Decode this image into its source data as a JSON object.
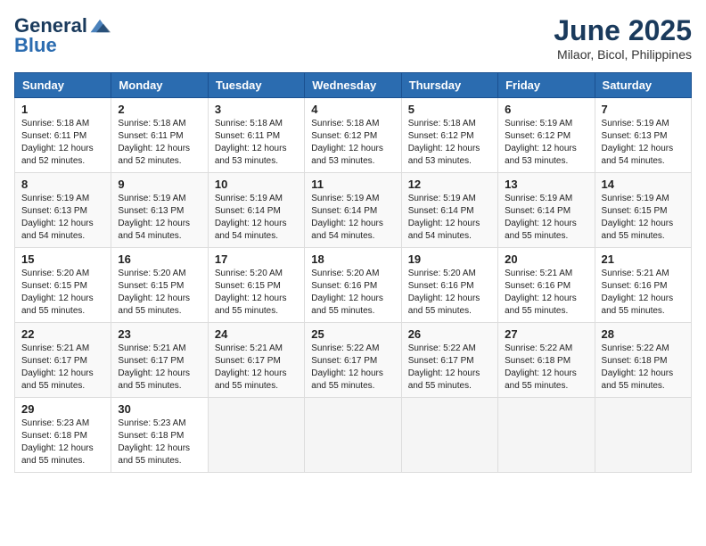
{
  "header": {
    "logo_general": "General",
    "logo_blue": "Blue",
    "month": "June 2025",
    "location": "Milaor, Bicol, Philippines"
  },
  "days_of_week": [
    "Sunday",
    "Monday",
    "Tuesday",
    "Wednesday",
    "Thursday",
    "Friday",
    "Saturday"
  ],
  "weeks": [
    [
      {
        "day": "1",
        "sunrise": "5:18 AM",
        "sunset": "6:11 PM",
        "daylight": "12 hours and 52 minutes."
      },
      {
        "day": "2",
        "sunrise": "5:18 AM",
        "sunset": "6:11 PM",
        "daylight": "12 hours and 52 minutes."
      },
      {
        "day": "3",
        "sunrise": "5:18 AM",
        "sunset": "6:11 PM",
        "daylight": "12 hours and 53 minutes."
      },
      {
        "day": "4",
        "sunrise": "5:18 AM",
        "sunset": "6:12 PM",
        "daylight": "12 hours and 53 minutes."
      },
      {
        "day": "5",
        "sunrise": "5:18 AM",
        "sunset": "6:12 PM",
        "daylight": "12 hours and 53 minutes."
      },
      {
        "day": "6",
        "sunrise": "5:19 AM",
        "sunset": "6:12 PM",
        "daylight": "12 hours and 53 minutes."
      },
      {
        "day": "7",
        "sunrise": "5:19 AM",
        "sunset": "6:13 PM",
        "daylight": "12 hours and 54 minutes."
      }
    ],
    [
      {
        "day": "8",
        "sunrise": "5:19 AM",
        "sunset": "6:13 PM",
        "daylight": "12 hours and 54 minutes."
      },
      {
        "day": "9",
        "sunrise": "5:19 AM",
        "sunset": "6:13 PM",
        "daylight": "12 hours and 54 minutes."
      },
      {
        "day": "10",
        "sunrise": "5:19 AM",
        "sunset": "6:14 PM",
        "daylight": "12 hours and 54 minutes."
      },
      {
        "day": "11",
        "sunrise": "5:19 AM",
        "sunset": "6:14 PM",
        "daylight": "12 hours and 54 minutes."
      },
      {
        "day": "12",
        "sunrise": "5:19 AM",
        "sunset": "6:14 PM",
        "daylight": "12 hours and 54 minutes."
      },
      {
        "day": "13",
        "sunrise": "5:19 AM",
        "sunset": "6:14 PM",
        "daylight": "12 hours and 55 minutes."
      },
      {
        "day": "14",
        "sunrise": "5:19 AM",
        "sunset": "6:15 PM",
        "daylight": "12 hours and 55 minutes."
      }
    ],
    [
      {
        "day": "15",
        "sunrise": "5:20 AM",
        "sunset": "6:15 PM",
        "daylight": "12 hours and 55 minutes."
      },
      {
        "day": "16",
        "sunrise": "5:20 AM",
        "sunset": "6:15 PM",
        "daylight": "12 hours and 55 minutes."
      },
      {
        "day": "17",
        "sunrise": "5:20 AM",
        "sunset": "6:15 PM",
        "daylight": "12 hours and 55 minutes."
      },
      {
        "day": "18",
        "sunrise": "5:20 AM",
        "sunset": "6:16 PM",
        "daylight": "12 hours and 55 minutes."
      },
      {
        "day": "19",
        "sunrise": "5:20 AM",
        "sunset": "6:16 PM",
        "daylight": "12 hours and 55 minutes."
      },
      {
        "day": "20",
        "sunrise": "5:21 AM",
        "sunset": "6:16 PM",
        "daylight": "12 hours and 55 minutes."
      },
      {
        "day": "21",
        "sunrise": "5:21 AM",
        "sunset": "6:16 PM",
        "daylight": "12 hours and 55 minutes."
      }
    ],
    [
      {
        "day": "22",
        "sunrise": "5:21 AM",
        "sunset": "6:17 PM",
        "daylight": "12 hours and 55 minutes."
      },
      {
        "day": "23",
        "sunrise": "5:21 AM",
        "sunset": "6:17 PM",
        "daylight": "12 hours and 55 minutes."
      },
      {
        "day": "24",
        "sunrise": "5:21 AM",
        "sunset": "6:17 PM",
        "daylight": "12 hours and 55 minutes."
      },
      {
        "day": "25",
        "sunrise": "5:22 AM",
        "sunset": "6:17 PM",
        "daylight": "12 hours and 55 minutes."
      },
      {
        "day": "26",
        "sunrise": "5:22 AM",
        "sunset": "6:17 PM",
        "daylight": "12 hours and 55 minutes."
      },
      {
        "day": "27",
        "sunrise": "5:22 AM",
        "sunset": "6:18 PM",
        "daylight": "12 hours and 55 minutes."
      },
      {
        "day": "28",
        "sunrise": "5:22 AM",
        "sunset": "6:18 PM",
        "daylight": "12 hours and 55 minutes."
      }
    ],
    [
      {
        "day": "29",
        "sunrise": "5:23 AM",
        "sunset": "6:18 PM",
        "daylight": "12 hours and 55 minutes."
      },
      {
        "day": "30",
        "sunrise": "5:23 AM",
        "sunset": "6:18 PM",
        "daylight": "12 hours and 55 minutes."
      },
      null,
      null,
      null,
      null,
      null
    ]
  ]
}
